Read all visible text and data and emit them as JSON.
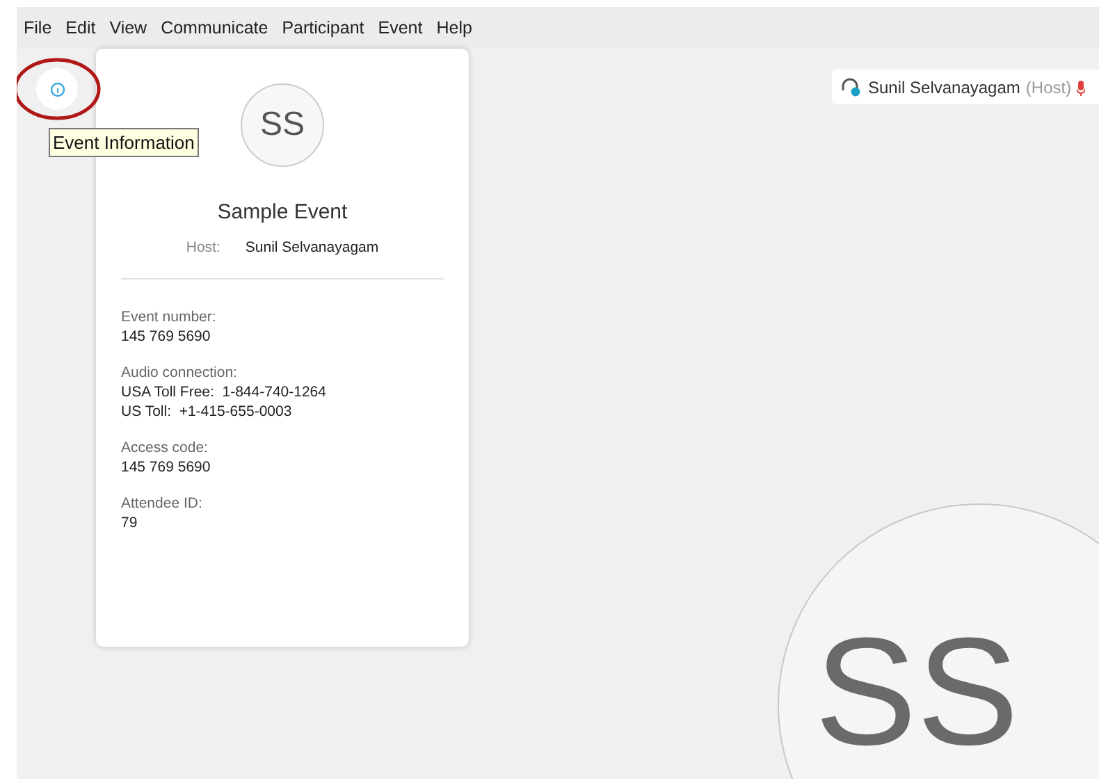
{
  "menu": [
    "File",
    "Edit",
    "View",
    "Communicate",
    "Participant",
    "Event",
    "Help"
  ],
  "info_button": {
    "tooltip": "Event Information"
  },
  "card": {
    "initials": "SS",
    "title": "Sample Event",
    "host_label": "Host:",
    "host_name": "Sunil Selvanayagam",
    "sections": [
      {
        "label": "Event number:",
        "lines": [
          "145 769 5690"
        ]
      },
      {
        "label": "Audio connection:",
        "lines": [
          "USA Toll Free:  1-844-740-1264",
          "US Toll:  +1-415-655-0003"
        ]
      },
      {
        "label": "Access code:",
        "lines": [
          "145 769 5690"
        ]
      },
      {
        "label": "Attendee ID:",
        "lines": [
          "79"
        ]
      }
    ]
  },
  "participant": {
    "name": "Sunil Selvanayagam",
    "role": "(Host)",
    "initials": "SS"
  }
}
